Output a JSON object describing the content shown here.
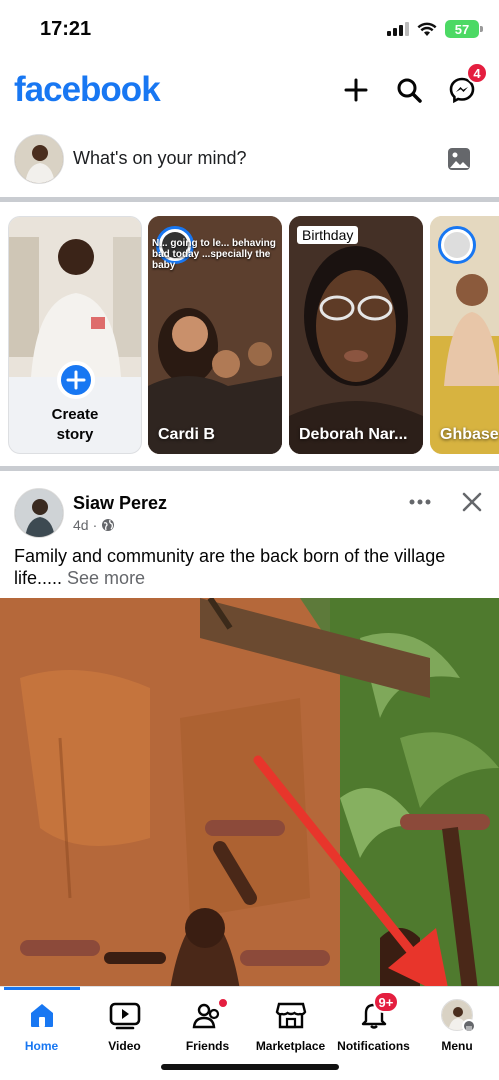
{
  "status_bar": {
    "time": "17:21",
    "battery": "57"
  },
  "header": {
    "logo": "facebook",
    "messenger_badge": "4"
  },
  "composer": {
    "placeholder": "What's on your mind?"
  },
  "stories": [
    {
      "name": "Create\nstory",
      "type": "create"
    },
    {
      "name": "Cardi B",
      "overlay_text": "N... going to le... behaving bad today ...specially the baby"
    },
    {
      "name": "Deborah Nar...",
      "tag": "Birthday"
    },
    {
      "name": "Ghbase"
    }
  ],
  "post": {
    "author": "Siaw Perez",
    "time": "4d",
    "text": "Family and community are the back born of the village life.....",
    "see_more": "See more"
  },
  "tabbar": {
    "tabs": [
      {
        "label": "Home",
        "active": true
      },
      {
        "label": "Video"
      },
      {
        "label": "Friends"
      },
      {
        "label": "Marketplace"
      },
      {
        "label": "Notifications",
        "badge": "9+"
      },
      {
        "label": "Menu"
      }
    ]
  },
  "colors": {
    "brand": "#1877f2",
    "badge": "#e41e3f",
    "arrow": "#e8352b"
  },
  "icons": [
    "plus-icon",
    "search-icon",
    "messenger-icon",
    "photo-icon",
    "globe-icon",
    "more-icon",
    "close-icon",
    "home-icon",
    "video-icon",
    "friends-icon",
    "marketplace-icon",
    "bell-icon"
  ]
}
